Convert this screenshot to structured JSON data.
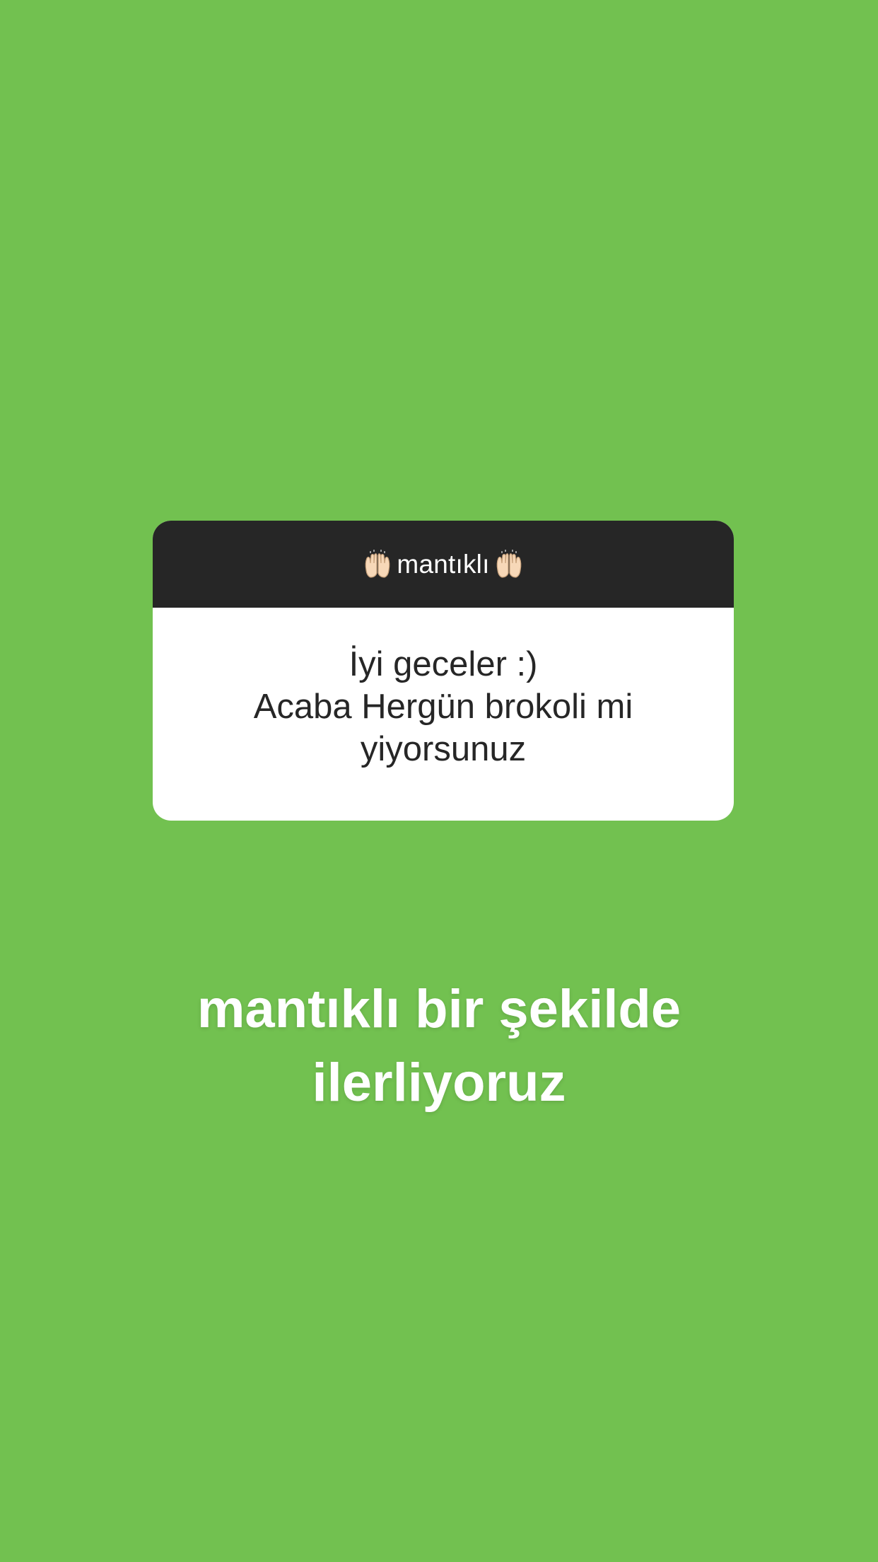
{
  "story": {
    "background_color": "#72c150"
  },
  "question_sticker": {
    "header_text": "mantıklı",
    "header_icon_left": "raised-hands-icon",
    "header_icon_right": "raised-hands-icon",
    "question_lines": [
      "İyi geceler :)",
      "Acaba Hergün brokoli mi",
      "yiyorsunuz"
    ],
    "header_color": "#262626",
    "body_color": "#ffffff"
  },
  "answer_text": {
    "lines": [
      "mantıklı bir şekilde",
      "ilerliyoruz"
    ]
  }
}
